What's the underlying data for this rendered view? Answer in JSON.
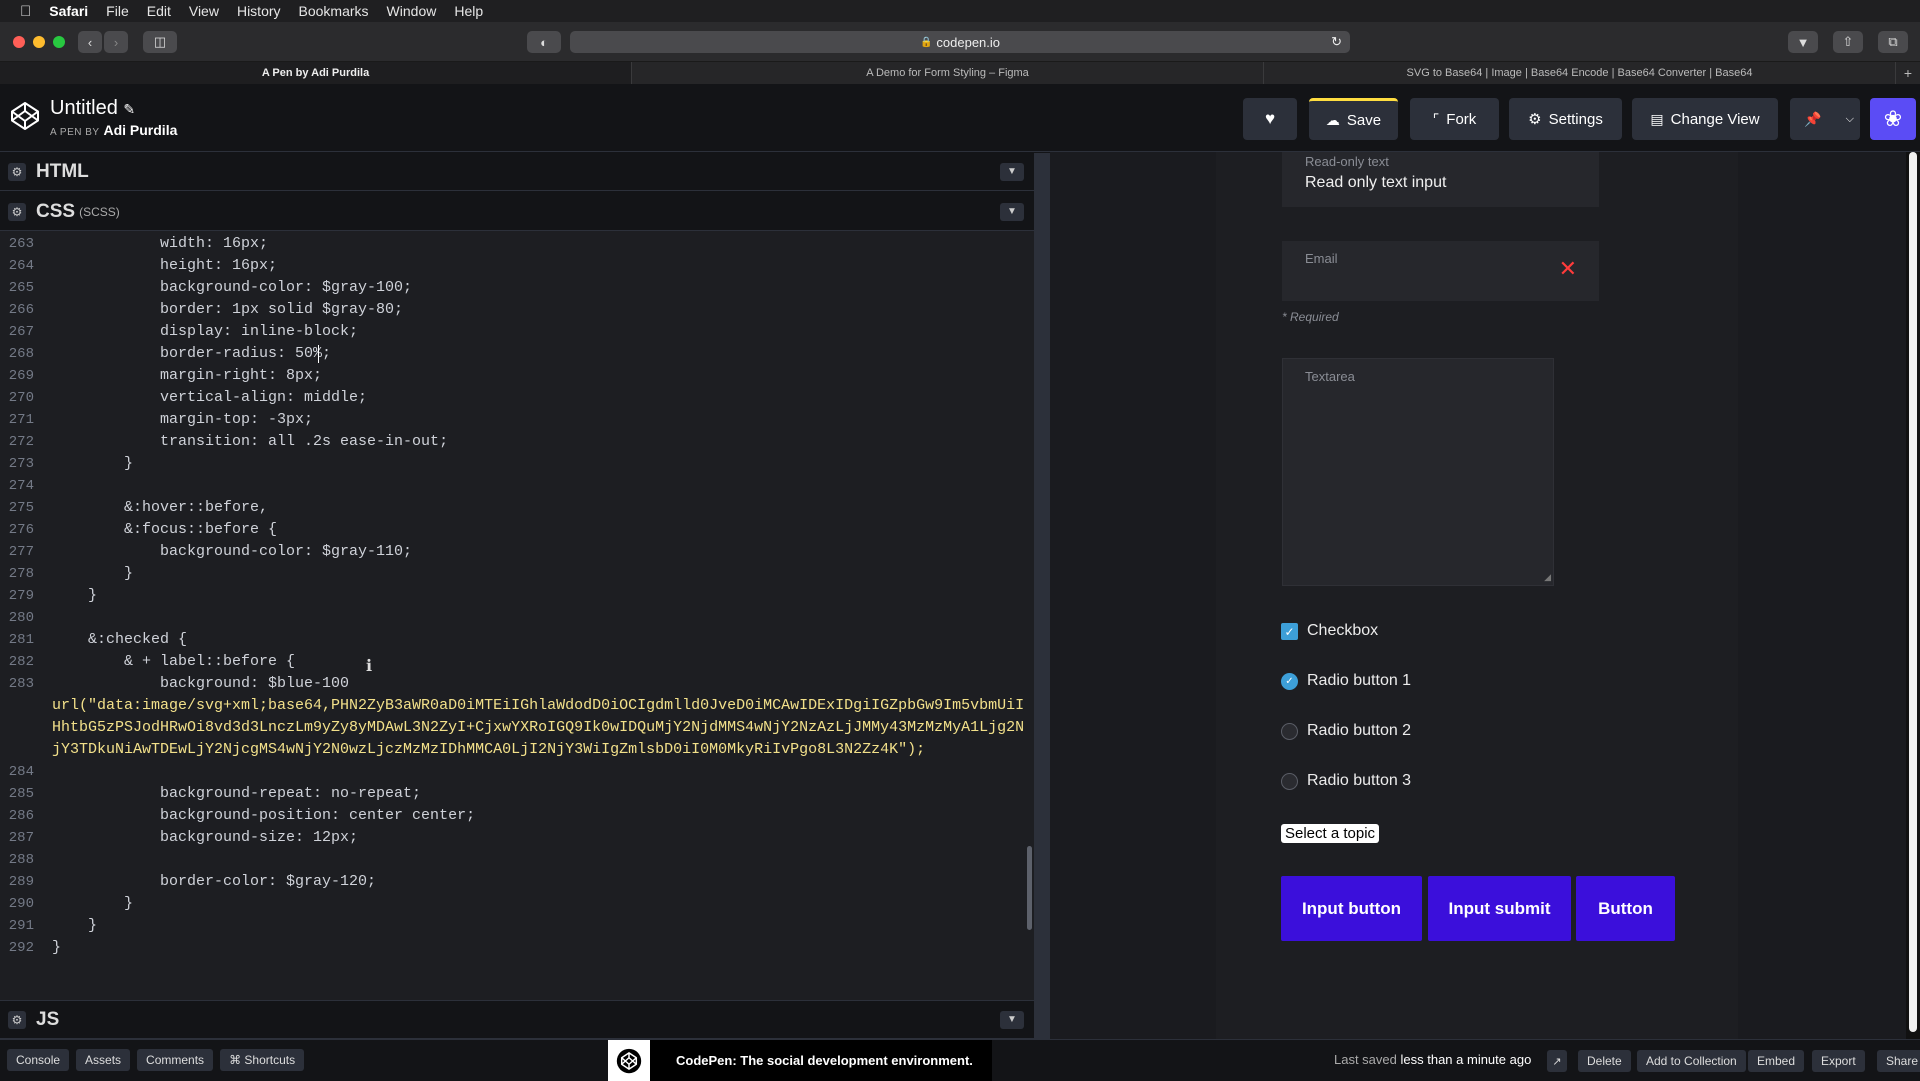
{
  "menubar": {
    "items": [
      "Safari",
      "File",
      "Edit",
      "View",
      "History",
      "Bookmarks",
      "Window",
      "Help"
    ]
  },
  "browser": {
    "url": "codepen.io",
    "tabs": [
      "A Pen by Adi Purdila",
      "A Demo for Form Styling – Figma",
      "SVG to Base64 | Image | Base64 Encode | Base64 Converter | Base64"
    ],
    "new_tab": "+"
  },
  "header": {
    "title": "Untitled",
    "byline_prefix": "A PEN BY",
    "author": "Adi Purdila",
    "save": "Save",
    "fork": "Fork",
    "settings": "Settings",
    "change_view": "Change View"
  },
  "editor": {
    "html_label": "HTML",
    "css_label": "CSS",
    "css_sub": "(SCSS)",
    "js_label": "JS",
    "lines": [
      {
        "n": "263",
        "t": "            width: 16px;"
      },
      {
        "n": "264",
        "t": "            height: 16px;"
      },
      {
        "n": "265",
        "t": "            background-color: $gray-100;"
      },
      {
        "n": "266",
        "t": "            border: 1px solid $gray-80;"
      },
      {
        "n": "267",
        "t": "            display: inline-block;"
      },
      {
        "n": "268",
        "t": "            border-radius: 50%;"
      },
      {
        "n": "269",
        "t": "            margin-right: 8px;"
      },
      {
        "n": "270",
        "t": "            vertical-align: middle;"
      },
      {
        "n": "271",
        "t": "            margin-top: -3px;"
      },
      {
        "n": "272",
        "t": "            transition: all .2s ease-in-out;"
      },
      {
        "n": "273",
        "t": "        }"
      },
      {
        "n": "274",
        "t": ""
      },
      {
        "n": "275",
        "t": "        &:hover::before,"
      },
      {
        "n": "276",
        "t": "        &:focus::before {"
      },
      {
        "n": "277",
        "t": "            background-color: $gray-110;"
      },
      {
        "n": "278",
        "t": "        }"
      },
      {
        "n": "279",
        "t": "    }"
      },
      {
        "n": "280",
        "t": ""
      },
      {
        "n": "281",
        "t": "    &:checked {"
      },
      {
        "n": "282",
        "t": "        & + label::before {"
      },
      {
        "n": "283",
        "t": "            background: $blue-100"
      }
    ],
    "url_line": "url(\"data:image/svg+xml;base64,PHN2ZyB3aWR0aD0iMTEiIGhlaWdodD0iOCIgdmlld0JveD0iMCAwIDExIDgiIGZpbGw9Im5vbmUiIHhtbG5zPSJodHRwOi8vd3d3LnczLm9yZy8yMDAwL3N2ZyI+CjxwYXRoIGQ9Ik0wIDQuMjY2NjdMMS4wNjY2NzAzLjJMMy43MzMzMyA1Ljg2NjY3TDkuNiAwTDEwLjY2NjcgMS4wNjY2N0wzLjczMzMzIDhMMCA0LjI2NjY3WiIgZmlsbD0iI0M0MkyRiIvPgo8L3N2Zz4K\");",
    "lines2": [
      {
        "n": "284",
        "t": ""
      },
      {
        "n": "285",
        "t": "            background-repeat: no-repeat;"
      },
      {
        "n": "286",
        "t": "            background-position: center center;"
      },
      {
        "n": "287",
        "t": "            background-size: 12px;"
      },
      {
        "n": "288",
        "t": ""
      },
      {
        "n": "289",
        "t": "            border-color: $gray-120;"
      },
      {
        "n": "290",
        "t": "        }"
      },
      {
        "n": "291",
        "t": "    }"
      },
      {
        "n": "292",
        "t": "}"
      }
    ]
  },
  "preview": {
    "readonly_label": "Read-only text",
    "readonly_value": "Read only text input",
    "email_label": "Email",
    "required": "* Required",
    "textarea_label": "Textarea",
    "checkbox": "Checkbox",
    "radio1": "Radio button 1",
    "radio2": "Radio button 2",
    "radio3": "Radio button 3",
    "select": "Select a topic",
    "btn_input": "Input button",
    "btn_submit": "Input submit",
    "btn_button": "Button"
  },
  "bottom": {
    "console": "Console",
    "assets": "Assets",
    "comments": "Comments",
    "shortcuts": "⌘ Shortcuts",
    "promo": "CodePen: The social development environment.",
    "saved_prefix": "Last saved",
    "saved_time": "less than a minute ago",
    "delete": "Delete",
    "add_collection": "Add to Collection",
    "embed": "Embed",
    "export": "Export",
    "share": "Share"
  },
  "colors": {
    "accent_purple": "#3b0fdb",
    "save_accent": "#ffdd40",
    "checkbox_blue": "#3d9fd8"
  }
}
